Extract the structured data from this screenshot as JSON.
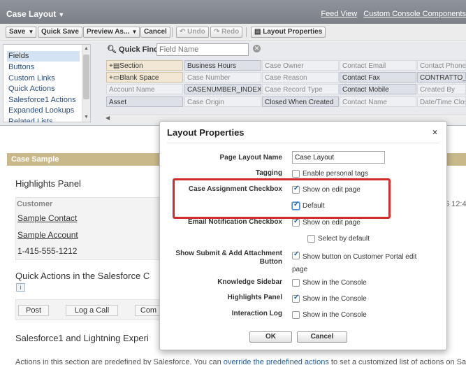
{
  "header": {
    "title": "Case Layout",
    "links": [
      "Feed View",
      "Custom Console Components"
    ]
  },
  "toolbar": {
    "save": "Save",
    "quick_save": "Quick Save",
    "preview_as": "Preview As...",
    "cancel": "Cancel",
    "undo": "Undo",
    "redo": "Redo",
    "layout_properties": "Layout Properties"
  },
  "palette": {
    "categories": [
      "Fields",
      "Buttons",
      "Custom Links",
      "Quick Actions",
      "Salesforce1 Actions",
      "Expanded Lookups",
      "Related Lists"
    ],
    "selected_category": "Fields",
    "quick_find_label": "Quick Find",
    "quick_find_placeholder": "Field Name",
    "fields": [
      [
        "Section",
        "Business Hours",
        "Case Owner",
        "Contact Email",
        "Contact Phone"
      ],
      [
        "Blank Space",
        "Case Number",
        "Case Reason",
        "Contact Fax",
        "CONTRATTO_"
      ],
      [
        "Account Name",
        "CASENUMBER_INDEXE",
        "Case Record Type",
        "Contact Mobile",
        "Created By"
      ],
      [
        "Asset",
        "Case Origin",
        "Closed When Created",
        "Contact Name",
        "Date/Time Clos"
      ]
    ]
  },
  "layout": {
    "section_header": "Case Sample",
    "highlights_title": "Highlights Panel",
    "customer_label": "Customer",
    "sample_contact": "Sample Contact",
    "sample_account": "Sample Account",
    "phone": "1-415-555-1212",
    "timestamp": "6 12:4",
    "quick_actions_title": "Quick Actions in the Salesforce C",
    "info_badge": "i",
    "qa_buttons": [
      "Post",
      "Log a Call",
      "Com"
    ],
    "sf1_title": "Salesforce1 and Lightning Experi",
    "footer_pre": "Actions in this section are predefined by Salesforce. You can ",
    "footer_link": "override the predefined actions",
    "footer_post": " to set a customized list of actions on Salesfor"
  },
  "modal": {
    "title": "Layout Properties",
    "close": "×",
    "page_layout_name_label": "Page Layout Name",
    "page_layout_name_value": "Case Layout",
    "tagging_label": "Tagging",
    "tagging_option": "Enable personal tags",
    "case_assignment_label": "Case Assignment Checkbox",
    "case_assignment_show": "Show on edit page",
    "case_assignment_default": "Default",
    "email_notification_label": "Email Notification Checkbox",
    "email_show": "Show on edit page",
    "email_select_default": "Select by default",
    "show_submit_label": "Show Submit & Add Attachment Button",
    "show_submit_option": "Show button on Customer Portal edit page",
    "knowledge_label": "Knowledge Sidebar",
    "knowledge_option": "Show in the Console",
    "highlights_label": "Highlights Panel",
    "highlights_option": "Show in the Console",
    "interaction_label": "Interaction Log",
    "interaction_option": "Show in the Console",
    "ok": "OK",
    "cancel": "Cancel"
  },
  "colors": {
    "header_bg": "#848890",
    "section_header_bg": "#c9b98a",
    "highlight_border": "#d52b2b",
    "link": "#2a5f9e"
  }
}
